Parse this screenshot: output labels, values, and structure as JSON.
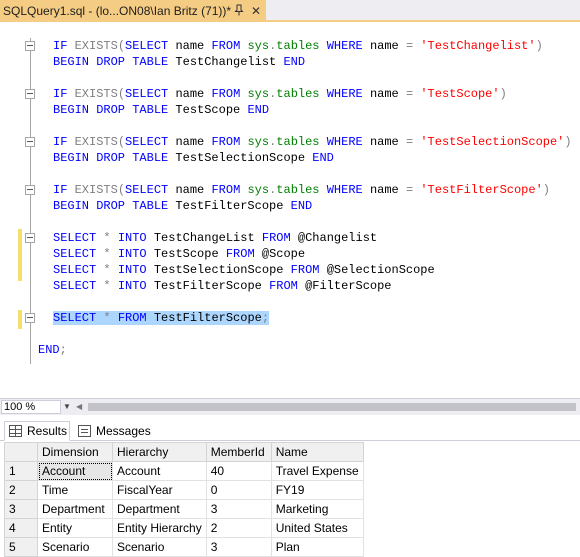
{
  "tab": {
    "title": "SQLQuery1.sql - (lo...ON08\\Ian Britz (71))*",
    "pin_icon": "pin-icon",
    "close_glyph": "✕"
  },
  "editor": {
    "lines": [
      {
        "parts": [
          [
            "kw",
            "IF "
          ],
          [
            "gray",
            "EXISTS"
          ],
          [
            "gray",
            "("
          ],
          [
            "kw",
            "SELECT "
          ],
          [
            "blk",
            "name "
          ],
          [
            "kw",
            "FROM "
          ],
          [
            "sys",
            "sys"
          ],
          [
            "gray",
            "."
          ],
          [
            "sys",
            "tables "
          ],
          [
            "kw",
            "WHERE "
          ],
          [
            "blk",
            "name "
          ],
          [
            "gray",
            "= "
          ],
          [
            "str",
            "'TestChangelist'"
          ],
          [
            "gray",
            ")"
          ]
        ]
      },
      {
        "parts": [
          [
            "kw",
            "BEGIN DROP TABLE "
          ],
          [
            "blk",
            "TestChangelist "
          ],
          [
            "kw",
            "END"
          ]
        ]
      },
      {
        "parts": [
          [
            "kw",
            "IF "
          ],
          [
            "gray",
            "EXISTS"
          ],
          [
            "gray",
            "("
          ],
          [
            "kw",
            "SELECT "
          ],
          [
            "blk",
            "name "
          ],
          [
            "kw",
            "FROM "
          ],
          [
            "sys",
            "sys"
          ],
          [
            "gray",
            "."
          ],
          [
            "sys",
            "tables "
          ],
          [
            "kw",
            "WHERE "
          ],
          [
            "blk",
            "name "
          ],
          [
            "gray",
            "= "
          ],
          [
            "str",
            "'TestScope'"
          ],
          [
            "gray",
            ")"
          ]
        ]
      },
      {
        "parts": [
          [
            "kw",
            "BEGIN DROP TABLE "
          ],
          [
            "blk",
            "TestScope "
          ],
          [
            "kw",
            "END"
          ]
        ]
      },
      {
        "parts": [
          [
            "kw",
            "IF "
          ],
          [
            "gray",
            "EXISTS"
          ],
          [
            "gray",
            "("
          ],
          [
            "kw",
            "SELECT "
          ],
          [
            "blk",
            "name "
          ],
          [
            "kw",
            "FROM "
          ],
          [
            "sys",
            "sys"
          ],
          [
            "gray",
            "."
          ],
          [
            "sys",
            "tables "
          ],
          [
            "kw",
            "WHERE "
          ],
          [
            "blk",
            "name "
          ],
          [
            "gray",
            "= "
          ],
          [
            "str",
            "'TestSelectionScope'"
          ],
          [
            "gray",
            ")"
          ]
        ]
      },
      {
        "parts": [
          [
            "kw",
            "BEGIN DROP TABLE "
          ],
          [
            "blk",
            "TestSelectionScope "
          ],
          [
            "kw",
            "END"
          ]
        ]
      },
      {
        "parts": [
          [
            "kw",
            "IF "
          ],
          [
            "gray",
            "EXISTS"
          ],
          [
            "gray",
            "("
          ],
          [
            "kw",
            "SELECT "
          ],
          [
            "blk",
            "name "
          ],
          [
            "kw",
            "FROM "
          ],
          [
            "sys",
            "sys"
          ],
          [
            "gray",
            "."
          ],
          [
            "sys",
            "tables "
          ],
          [
            "kw",
            "WHERE "
          ],
          [
            "blk",
            "name "
          ],
          [
            "gray",
            "= "
          ],
          [
            "str",
            "'TestFilterScope'"
          ],
          [
            "gray",
            ")"
          ]
        ]
      },
      {
        "parts": [
          [
            "kw",
            "BEGIN DROP TABLE "
          ],
          [
            "blk",
            "TestFilterScope "
          ],
          [
            "kw",
            "END"
          ]
        ]
      },
      {
        "parts": [
          [
            "kw",
            "SELECT "
          ],
          [
            "gray",
            "* "
          ],
          [
            "kw",
            "INTO "
          ],
          [
            "blk",
            "TestChangeList "
          ],
          [
            "kw",
            "FROM "
          ],
          [
            "blk",
            "@Changelist"
          ]
        ]
      },
      {
        "parts": [
          [
            "kw",
            "SELECT "
          ],
          [
            "gray",
            "* "
          ],
          [
            "kw",
            "INTO "
          ],
          [
            "blk",
            "TestScope "
          ],
          [
            "kw",
            "FROM "
          ],
          [
            "blk",
            "@Scope"
          ]
        ]
      },
      {
        "parts": [
          [
            "kw",
            "SELECT "
          ],
          [
            "gray",
            "* "
          ],
          [
            "kw",
            "INTO "
          ],
          [
            "blk",
            "TestSelectionScope "
          ],
          [
            "kw",
            "FROM "
          ],
          [
            "blk",
            "@SelectionScope"
          ]
        ]
      },
      {
        "parts": [
          [
            "kw",
            "SELECT "
          ],
          [
            "gray",
            "* "
          ],
          [
            "kw",
            "INTO "
          ],
          [
            "blk",
            "TestFilterScope "
          ],
          [
            "kw",
            "FROM "
          ],
          [
            "blk",
            "@FilterScope"
          ]
        ]
      },
      {
        "parts": [
          [
            "kw",
            "SELECT "
          ],
          [
            "gray",
            "* "
          ],
          [
            "kw",
            "FROM "
          ],
          [
            "blk",
            "TestFilterScope"
          ],
          [
            "gray",
            ";"
          ]
        ],
        "selected": true
      },
      {
        "parts": [
          [
            "kw",
            "END"
          ],
          [
            "gray",
            ";"
          ]
        ]
      }
    ]
  },
  "statusbar": {
    "zoom": "100 %"
  },
  "results": {
    "tabs": [
      {
        "label": "Results",
        "icon": "results-grid-icon"
      },
      {
        "label": "Messages",
        "icon": "messages-icon"
      }
    ],
    "columns": [
      "Dimension",
      "Hierarchy",
      "MemberId",
      "Name"
    ],
    "rows": [
      {
        "num": "1",
        "cells": [
          "Account",
          "Account",
          "40",
          "Travel Expense"
        ]
      },
      {
        "num": "2",
        "cells": [
          "Time",
          "FiscalYear",
          "0",
          "FY19"
        ]
      },
      {
        "num": "3",
        "cells": [
          "Department",
          "Department",
          "3",
          "Marketing"
        ]
      },
      {
        "num": "4",
        "cells": [
          "Entity",
          "Entity Hierarchy",
          "2",
          "United States"
        ]
      },
      {
        "num": "5",
        "cells": [
          "Scenario",
          "Scenario",
          "3",
          "Plan"
        ]
      }
    ]
  }
}
